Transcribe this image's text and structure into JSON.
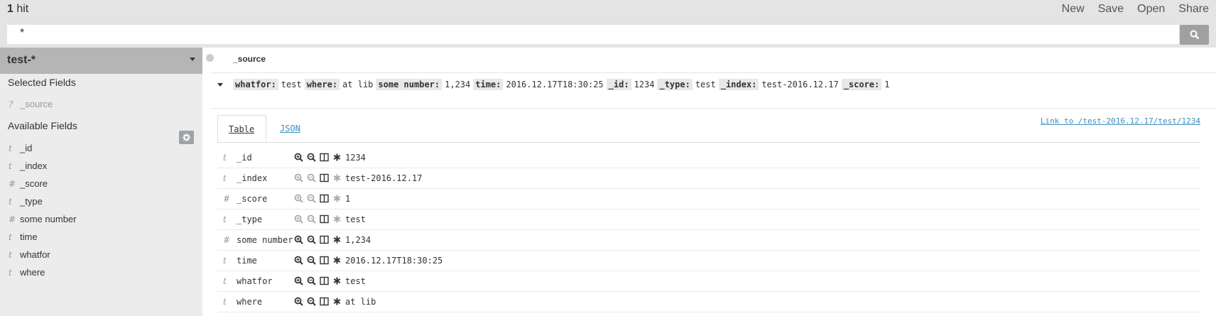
{
  "topbar": {
    "hit_count": "1",
    "hit_label": " hit",
    "menu": [
      "New",
      "Save",
      "Open",
      "Share"
    ]
  },
  "search": {
    "query": "*",
    "icon": "search-icon"
  },
  "sidebar": {
    "index_pattern": "test-*",
    "selected_heading": "Selected Fields",
    "selected_fields": [
      {
        "type": "?",
        "name": "_source"
      }
    ],
    "available_heading": "Available Fields",
    "available_fields": [
      {
        "type": "t",
        "name": "_id"
      },
      {
        "type": "t",
        "name": "_index"
      },
      {
        "type": "#",
        "name": "_score"
      },
      {
        "type": "t",
        "name": "_type"
      },
      {
        "type": "#",
        "name": "some number"
      },
      {
        "type": "t",
        "name": "time"
      },
      {
        "type": "t",
        "name": "whatfor"
      },
      {
        "type": "t",
        "name": "where"
      }
    ]
  },
  "main": {
    "column_header": "_source",
    "summary": [
      {
        "key": "whatfor:",
        "value": "test"
      },
      {
        "key": "where:",
        "value": "at lib"
      },
      {
        "key": "some number:",
        "value": "1,234"
      },
      {
        "key": "time:",
        "value": "2016.12.17T18:30:25"
      },
      {
        "key": "_id:",
        "value": "1234"
      },
      {
        "key": "_type:",
        "value": "test"
      },
      {
        "key": "_index:",
        "value": "test-2016.12.17"
      },
      {
        "key": "_score:",
        "value": "1"
      }
    ],
    "tabs": {
      "table": "Table",
      "json": "JSON"
    },
    "link": "Link to /test-2016.12.17/test/1234",
    "rows": [
      {
        "type": "t",
        "field": "_id",
        "value": "1234",
        "filterable": true
      },
      {
        "type": "t",
        "field": "_index",
        "value": "test-2016.12.17",
        "filterable": false
      },
      {
        "type": "#",
        "field": "_score",
        "value": "1",
        "filterable": false
      },
      {
        "type": "t",
        "field": "_type",
        "value": "test",
        "filterable": false
      },
      {
        "type": "#",
        "field": "some number",
        "value": "1,234",
        "filterable": true
      },
      {
        "type": "t",
        "field": "time",
        "value": "2016.12.17T18:30:25",
        "filterable": true
      },
      {
        "type": "t",
        "field": "whatfor",
        "value": "test",
        "filterable": true
      },
      {
        "type": "t",
        "field": "where",
        "value": "at lib",
        "filterable": true
      }
    ]
  }
}
